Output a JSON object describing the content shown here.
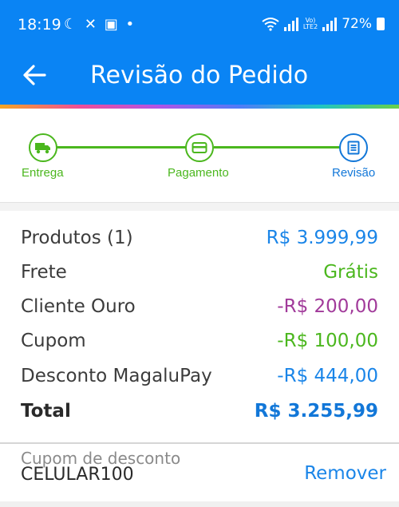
{
  "status_bar": {
    "time": "18:19",
    "icons_left": [
      "moon-icon",
      "people-icon",
      "mail-icon",
      "dot-icon"
    ],
    "volte_label": "Vo)\nLTE2",
    "battery": "72%"
  },
  "header": {
    "title": "Revisão do Pedido",
    "back_icon": "arrow-left-icon",
    "background": "#0a84f4"
  },
  "stepper": {
    "steps": [
      {
        "label": "Entrega",
        "icon": "truck-icon",
        "color": "#4bb71e"
      },
      {
        "label": "Pagamento",
        "icon": "card-icon",
        "color": "#4bb71e"
      },
      {
        "label": "Revisão",
        "icon": "receipt-icon",
        "color": "#1277d8"
      }
    ]
  },
  "summary": {
    "rows": [
      {
        "label": "Produtos (1)",
        "value": "R$ 3.999,99",
        "color": "#1a85e8"
      },
      {
        "label": "Frete",
        "value": "Grátis",
        "color": "#4bb71e"
      },
      {
        "label": "Cliente Ouro",
        "value": "-R$ 200,00",
        "color": "#a13a9a"
      },
      {
        "label": "Cupom",
        "value": "-R$ 100,00",
        "color": "#4bb71e"
      },
      {
        "label": "Desconto MagaluPay",
        "value": "-R$ 444,00",
        "color": "#1a85e8"
      }
    ],
    "total_label": "Total",
    "total_value": "R$ 3.255,99"
  },
  "coupon": {
    "label": "Cupom de desconto",
    "code": "CELULAR100",
    "remove_label": "Remover"
  }
}
